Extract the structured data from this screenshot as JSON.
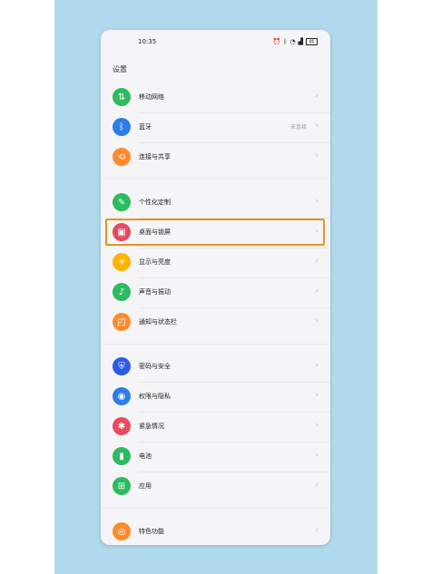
{
  "status_bar": {
    "time": "10:35",
    "battery": "86"
  },
  "page": {
    "title": "设置"
  },
  "settings": [
    {
      "label": "移动网络",
      "value": "",
      "icon": "mobile-data-icon",
      "color": "#2dbb5e",
      "glyph": "⇅"
    },
    {
      "label": "蓝牙",
      "value": "未连接",
      "icon": "bluetooth-icon",
      "color": "#2b7de9",
      "glyph": "ᛒ"
    },
    {
      "label": "连接与共享",
      "value": "",
      "icon": "share-icon",
      "color": "#ff8a2a",
      "glyph": "⟲"
    },
    {
      "label": "个性化定制",
      "value": "",
      "icon": "personalize-icon",
      "color": "#2dbb5e",
      "glyph": "✎"
    },
    {
      "label": "桌面与锁屏",
      "value": "",
      "icon": "wallpaper-icon",
      "color": "#e84a5f",
      "glyph": "▣"
    },
    {
      "label": "显示与亮度",
      "value": "",
      "icon": "brightness-icon",
      "color": "#ffb300",
      "glyph": "☀"
    },
    {
      "label": "声音与振动",
      "value": "",
      "icon": "sound-icon",
      "color": "#2dbb5e",
      "glyph": "♪"
    },
    {
      "label": "通知与状态栏",
      "value": "",
      "icon": "notification-icon",
      "color": "#ff8a2a",
      "glyph": "◰"
    },
    {
      "label": "密码与安全",
      "value": "",
      "icon": "security-icon",
      "color": "#2b5be9",
      "glyph": "⛨"
    },
    {
      "label": "权限与隐私",
      "value": "",
      "icon": "privacy-icon",
      "color": "#2b7de9",
      "glyph": "◉"
    },
    {
      "label": "紧急情况",
      "value": "",
      "icon": "emergency-icon",
      "color": "#e84a5f",
      "glyph": "✱"
    },
    {
      "label": "电池",
      "value": "",
      "icon": "battery-icon",
      "color": "#2dbb5e",
      "glyph": "▮"
    },
    {
      "label": "应用",
      "value": "",
      "icon": "apps-icon",
      "color": "#2dbb5e",
      "glyph": "⊞"
    },
    {
      "label": "特色功能",
      "value": "",
      "icon": "features-icon",
      "color": "#ff8a2a",
      "glyph": "◎"
    }
  ]
}
